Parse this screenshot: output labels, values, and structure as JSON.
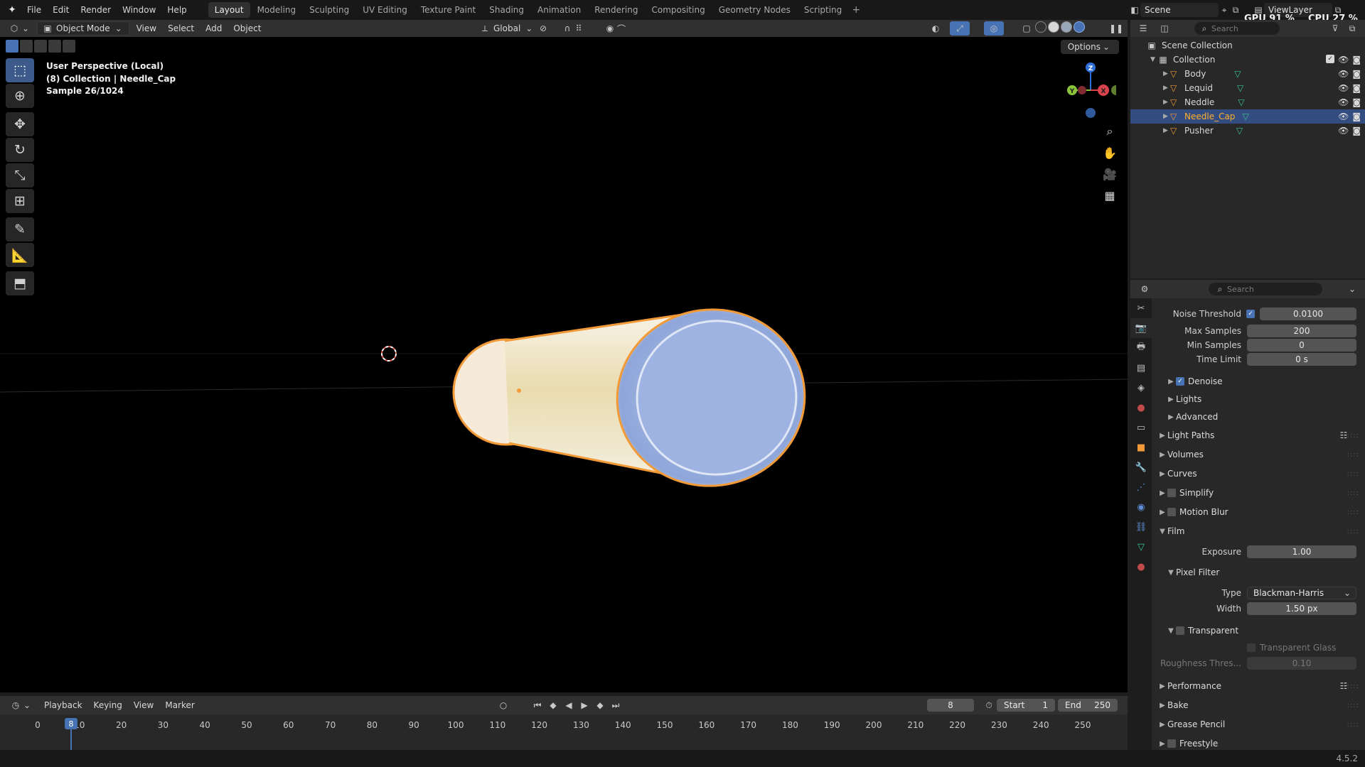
{
  "topbar": {
    "menus": [
      "File",
      "Edit",
      "Render",
      "Window",
      "Help"
    ],
    "workspaces": [
      "Layout",
      "Modeling",
      "Sculpting",
      "UV Editing",
      "Texture Paint",
      "Shading",
      "Animation",
      "Rendering",
      "Compositing",
      "Geometry Nodes",
      "Scripting"
    ],
    "active_workspace": "Layout",
    "add_workspace": "+",
    "scene": "Scene",
    "view_layer": "ViewLayer",
    "gpu": "GPU 91 %",
    "cpu": "CPU 27 %"
  },
  "viewport_header": {
    "mode": "Object Mode",
    "menus": [
      "View",
      "Select",
      "Add",
      "Object"
    ],
    "orientation": "Global"
  },
  "viewport": {
    "options": "Options",
    "overlay_line1": "User Perspective (Local)",
    "overlay_line2": "(8) Collection | Needle_Cap",
    "overlay_line3": "Sample 26/1024",
    "gizmo_axes": [
      "Z",
      "Y",
      "X"
    ]
  },
  "timeline": {
    "menus": [
      "Playback",
      "Keying",
      "View",
      "Marker"
    ],
    "current_frame": "8",
    "start_label": "Start",
    "start_value": "1",
    "end_label": "End",
    "end_value": "250",
    "ruler": [
      "0",
      "10",
      "20",
      "30",
      "40",
      "50",
      "60",
      "70",
      "80",
      "90",
      "100",
      "110",
      "120",
      "130",
      "140",
      "150",
      "160",
      "170",
      "180",
      "190",
      "200",
      "210",
      "220",
      "230",
      "240",
      "250"
    ],
    "playhead_frame": "8"
  },
  "outliner": {
    "search_placeholder": "Search",
    "scene_collection": "Scene Collection",
    "collection": "Collection",
    "objects": [
      {
        "name": "Body",
        "selected": false
      },
      {
        "name": "Lequid",
        "selected": false
      },
      {
        "name": "Neddle",
        "selected": false
      },
      {
        "name": "Needle_Cap",
        "selected": true
      },
      {
        "name": "Pusher",
        "selected": false
      }
    ]
  },
  "properties": {
    "search_placeholder": "Search",
    "noise_threshold_label": "Noise Threshold",
    "noise_threshold_value": "0.0100",
    "max_samples_label": "Max Samples",
    "max_samples_value": "200",
    "min_samples_label": "Min Samples",
    "min_samples_value": "0",
    "time_limit_label": "Time Limit",
    "time_limit_value": "0 s",
    "denoise": "Denoise",
    "lights": "Lights",
    "advanced": "Advanced",
    "light_paths": "Light Paths",
    "volumes": "Volumes",
    "curves": "Curves",
    "simplify": "Simplify",
    "motion_blur": "Motion Blur",
    "film": "Film",
    "exposure_label": "Exposure",
    "exposure_value": "1.00",
    "pixel_filter": "Pixel Filter",
    "type_label": "Type",
    "type_value": "Blackman-Harris",
    "width_label": "Width",
    "width_value": "1.50 px",
    "transparent": "Transparent",
    "transparent_glass": "Transparent Glass",
    "roughness_label": "Roughness Thres...",
    "roughness_value": "0.10",
    "performance": "Performance",
    "bake": "Bake",
    "grease_pencil": "Grease Pencil",
    "freestyle": "Freestyle"
  },
  "statusbar": {
    "version": "4.5.2"
  },
  "colors": {
    "accent": "#4772b3",
    "selected_text": "#ffaf29",
    "object_icon": "#f29a38",
    "mesh_icon": "#3bc293"
  }
}
